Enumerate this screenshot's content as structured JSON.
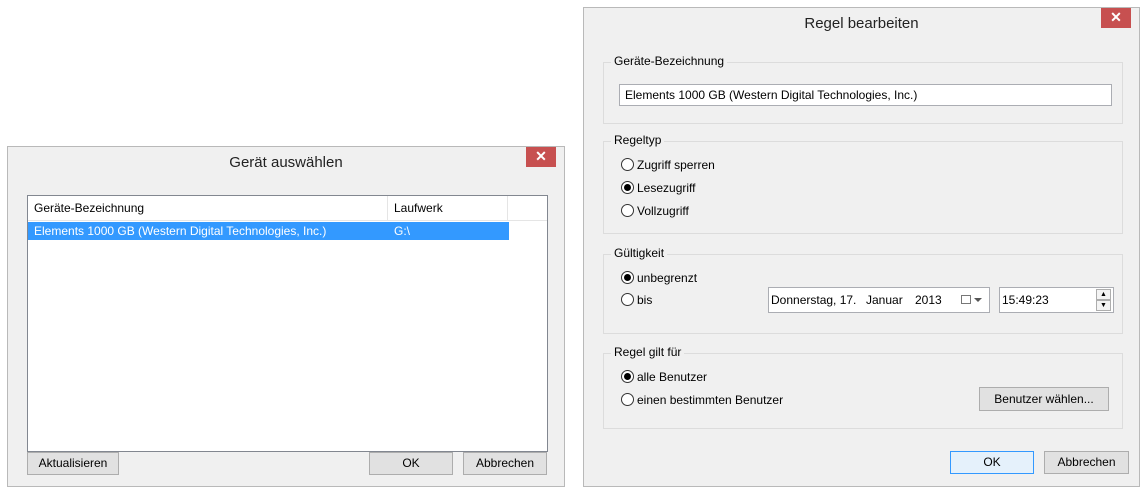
{
  "dialog_select": {
    "title": "Gerät auswählen",
    "close_glyph": "✕",
    "columns": [
      "Geräte-Bezeichnung",
      "Laufwerk"
    ],
    "rows": [
      {
        "name": "Elements 1000 GB (Western Digital Technologies, Inc.)",
        "drive": "G:\\",
        "selected": true
      }
    ],
    "refresh_label": "Aktualisieren",
    "ok_label": "OK",
    "cancel_label": "Abbrechen"
  },
  "dialog_rule": {
    "title": "Regel bearbeiten",
    "close_glyph": "✕",
    "device_group": {
      "label": "Geräte-Bezeichnung",
      "value": "Elements 1000 GB (Western Digital Technologies, Inc.)"
    },
    "ruletype_group": {
      "label": "Regeltyp",
      "options": [
        {
          "label": "Zugriff sperren",
          "checked": false
        },
        {
          "label": "Lesezugriff",
          "checked": true
        },
        {
          "label": "Vollzugriff",
          "checked": false
        }
      ]
    },
    "validity_group": {
      "label": "Gültigkeit",
      "options": [
        {
          "label": "unbegrenzt",
          "checked": true
        },
        {
          "label": "bis",
          "checked": false
        }
      ],
      "date_weekday": "Donnerstag, 17.",
      "date_month": "Januar",
      "date_year": "2013",
      "time": "15:49:23",
      "calendar_icon": "calendar-icon",
      "spin_up": "▲",
      "spin_down": "▼"
    },
    "applies_group": {
      "label": "Regel gilt für",
      "options": [
        {
          "label": "alle Benutzer",
          "checked": true
        },
        {
          "label": "einen bestimmten Benutzer",
          "checked": false
        }
      ],
      "choose_users_label": "Benutzer wählen..."
    },
    "ok_label": "OK",
    "cancel_label": "Abbrechen"
  },
  "colors": {
    "selection": "#3399ff",
    "close": "#c75050",
    "dialog_bg": "#f0f0f0"
  }
}
